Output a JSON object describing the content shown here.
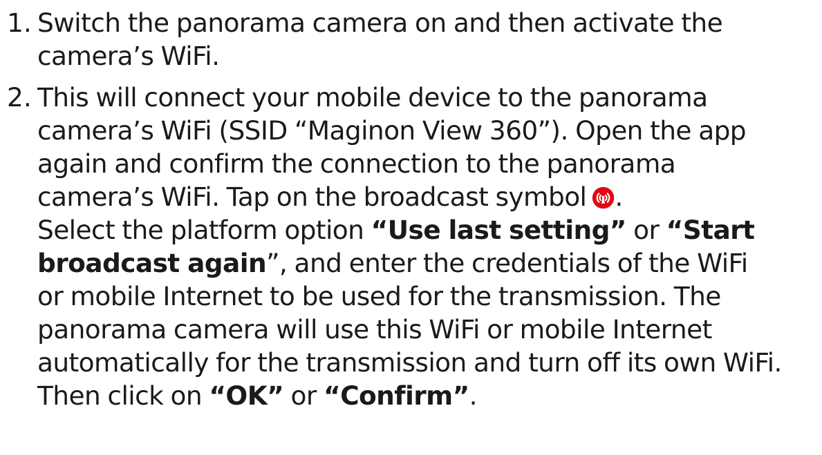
{
  "steps": [
    {
      "number": "1.",
      "lines": [
        "Switch the panorama camera on and then activate the",
        "camera’s WiFi."
      ]
    },
    {
      "number": "2.",
      "lines": [
        "This will connect your mobile device to the panorama",
        "camera’s WiFi (SSID “Maginon View 360”). Open the app",
        "again and confirm the connection to the panorama"
      ],
      "icon_line": {
        "text": "camera’s WiFi. Tap on the broadcast symbol",
        "icon": "broadcast-icon",
        "icon_color": "#e30613",
        "after": "."
      },
      "select_line": {
        "before": "Select the platform option ",
        "option1": "“Use last setting”",
        "middle": " or ",
        "option2_part1": "“Start"
      },
      "broadcast_line": {
        "option2_part2": "broadcast again",
        "quote_close": "”",
        "after": ", and enter the credentials of the WiFi"
      },
      "more_lines": [
        "or mobile Internet to be used for the transmission. The",
        "panorama camera will use this WiFi or mobile Internet",
        "automatically for the transmission and turn off its own WiFi."
      ],
      "final_line": {
        "before": "Then click on ",
        "option1": "“OK”",
        "middle": " or ",
        "option2": "“Confirm”",
        "after": "."
      }
    }
  ]
}
